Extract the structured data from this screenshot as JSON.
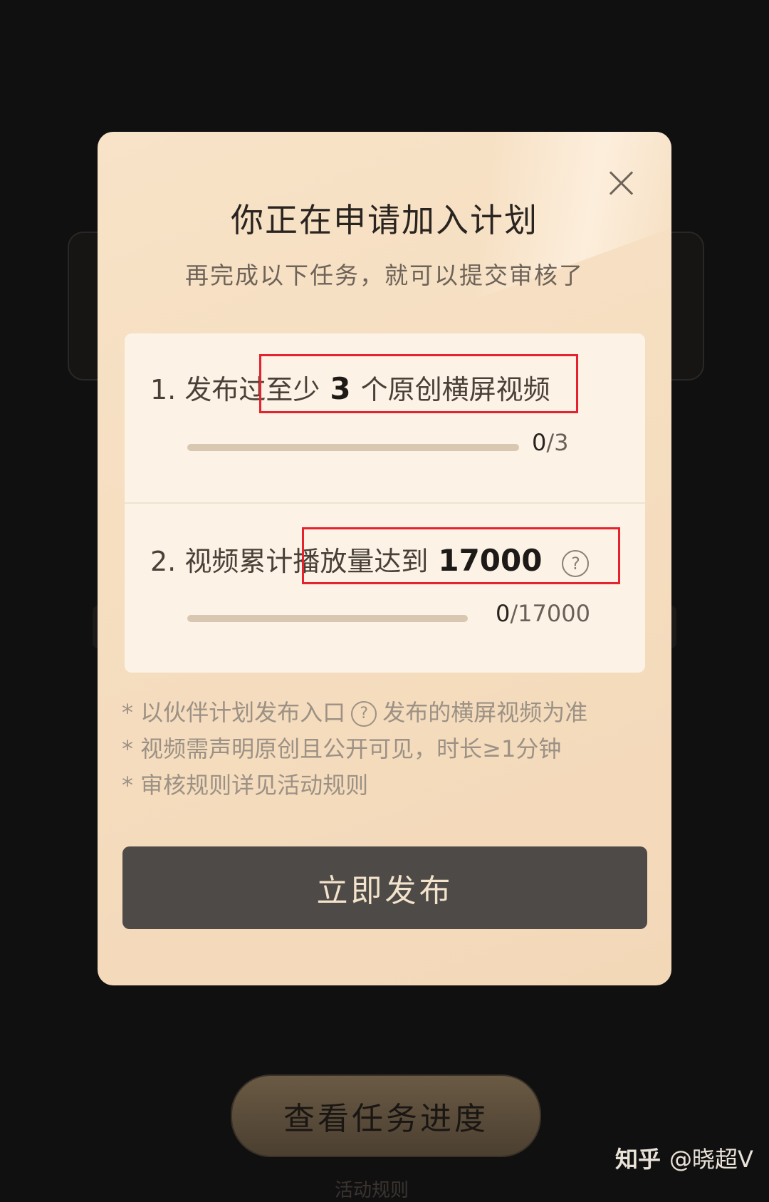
{
  "modal": {
    "title": "你正在申请加入计划",
    "subtitle": "再完成以下任务，就可以提交审核了",
    "close_icon": "close-icon",
    "tasks": [
      {
        "prefix": "1. 发布过至少",
        "number": "3",
        "suffix": "个原创横屏视频",
        "progress_current": "0",
        "progress_total": "/3",
        "progress_fraction": 0
      },
      {
        "prefix": "2. 视频累计播放量达到",
        "number": "17000",
        "suffix": "",
        "help_icon": "?",
        "progress_current": "0",
        "progress_total": "/17000",
        "progress_fraction": 0
      }
    ],
    "notes": {
      "n1_before": "* 以伙伴计划发布入口",
      "n1_icon": "?",
      "n1_after": "发布的横屏视频为准",
      "n2": "* 视频需声明原创且公开可见，时长≥1分钟",
      "n3": "* 审核规则详见活动规则"
    },
    "publish_label": "立即发布"
  },
  "background": {
    "progress_button_label": "查看任务进度",
    "rules_link": "活动规则"
  },
  "watermark": {
    "site": "知乎",
    "author": "@晓超V"
  },
  "colors": {
    "highlight_box": "#e5222d",
    "modal_bg": "#f6dfc2",
    "publish_bg": "#4d4a47"
  }
}
